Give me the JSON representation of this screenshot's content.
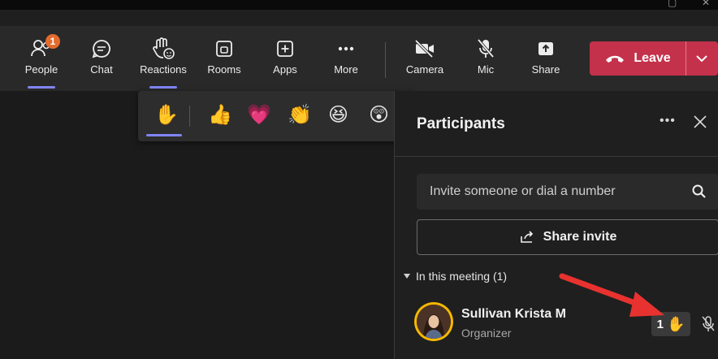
{
  "toolbar": {
    "people": {
      "label": "People",
      "badge": "1"
    },
    "chat": {
      "label": "Chat"
    },
    "reactions": {
      "label": "Reactions"
    },
    "rooms": {
      "label": "Rooms"
    },
    "apps": {
      "label": "Apps"
    },
    "more": {
      "label": "More"
    },
    "camera": {
      "label": "Camera"
    },
    "mic": {
      "label": "Mic"
    },
    "share": {
      "label": "Share"
    },
    "leave": {
      "label": "Leave"
    }
  },
  "reactions_bar": {
    "items": [
      {
        "name": "raise-hand",
        "glyph": "✋"
      },
      {
        "name": "like",
        "glyph": "👍"
      },
      {
        "name": "heart",
        "glyph": "💗"
      },
      {
        "name": "applause",
        "glyph": "👏"
      },
      {
        "name": "laugh",
        "glyph": "😆"
      },
      {
        "name": "surprised",
        "glyph": "😲"
      }
    ],
    "selected": "raise-hand"
  },
  "panel": {
    "title": "Participants",
    "more_glyph": "•••",
    "search_placeholder": "Invite someone or dial a number",
    "share_invite_label": "Share invite",
    "section_label": "In this meeting (1)",
    "participants": [
      {
        "name": "Sullivan Krista M",
        "role": "Organizer",
        "raised_hands": "1",
        "hand_glyph": "✋"
      }
    ]
  },
  "colors": {
    "accent": "#7f85f5",
    "leave": "#c4314b",
    "badge": "#e36c2d",
    "arrow": "#e8322f",
    "avatar_ring": "#f5b800"
  }
}
